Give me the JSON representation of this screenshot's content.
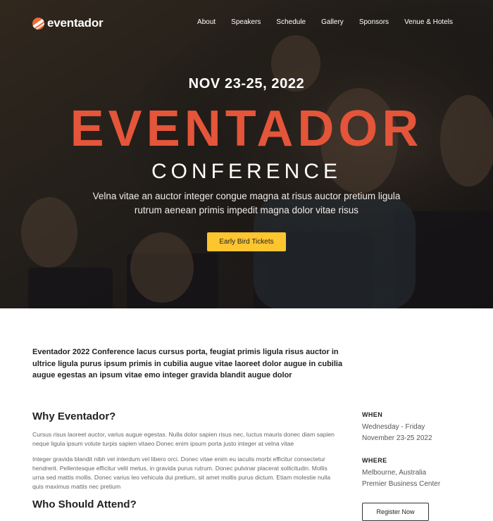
{
  "brand": {
    "name": "eventador",
    "accent": "#e4553a",
    "cta_color": "#fdc52f"
  },
  "nav": {
    "items": [
      "About",
      "Speakers",
      "Schedule",
      "Gallery",
      "Sponsors",
      "Venue & Hotels"
    ]
  },
  "hero": {
    "date": "NOV 23-25, 2022",
    "title": "EVENTADOR",
    "subtitle": "CONFERENCE",
    "description": "Velna vitae an auctor integer congue magna at risus auctor pretium ligula rutrum aenean primis impedit magna dolor vitae risus",
    "cta_label": "Early Bird Tickets"
  },
  "intro": "Eventador 2022 Conference lacus cursus porta, feugiat primis ligula risus auctor in ultrice ligula purus ipsum primis in cubilia augue vitae laoreet dolor augue in cubilia augue egestas an ipsum vitae emo integer gravida blandit augue dolor",
  "why": {
    "heading": "Why Eventador?",
    "paragraphs": [
      "Cursus risus laoreet auctor, varius augue egestas. Nulla dolor sapien risus nec, luctus mauris donec diam sapien neque ligula ipsum volute turpis sapien vitaeo Donec enim ipsum porta justo integer at velna vitae",
      "Integer gravida blandit nibh vel interdum vel libero orci. Donec vitae enim eu iaculis morbi efficitur consectetur hendrerit. Pellentesque efficitur velit metus, in gravida purus rutrum. Donec pulvinar placerat sollicitudin. Mollis urna sed mattis mollis. Donec varius leo vehicula dui pretium, sit amet mollis purus dictum. Etiam molestie nulla quis maximus mattis nec pretium"
    ]
  },
  "who": {
    "heading": "Who Should Attend?"
  },
  "sidebar": {
    "when_label": "WHEN",
    "when_line1": "Wednesday - Friday",
    "when_line2": "November 23-25 2022",
    "where_label": "WHERE",
    "where_line1": "Melbourne, Australia",
    "where_line2": "Premier Business Center",
    "register_label": "Register Now"
  }
}
